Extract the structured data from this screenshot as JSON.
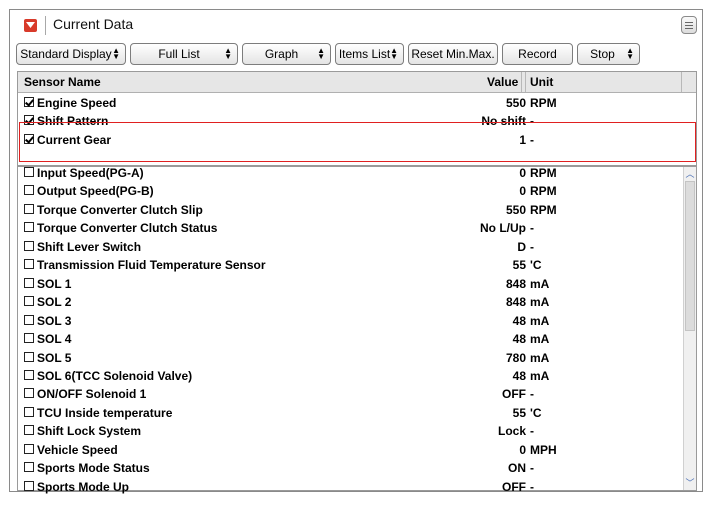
{
  "window": {
    "title": "Current Data"
  },
  "toolbar": {
    "standard_display": "Standard Display",
    "full_list": "Full List",
    "graph": "Graph",
    "items_list": "Items List",
    "reset_min_max": "Reset Min.Max.",
    "record": "Record",
    "stop": "Stop"
  },
  "table": {
    "headers": {
      "name": "Sensor Name",
      "value": "Value",
      "unit": "Unit"
    },
    "pinned_rows": [
      {
        "checked": true,
        "name": "Engine Speed",
        "value": "550",
        "unit": "RPM"
      },
      {
        "checked": true,
        "name": "Shift Pattern",
        "value": "No shift",
        "unit": "-"
      },
      {
        "checked": true,
        "name": "Current Gear",
        "value": "1",
        "unit": "-"
      }
    ],
    "rows": [
      {
        "checked": false,
        "name": "Input Speed(PG-A)",
        "value": "0",
        "unit": "RPM"
      },
      {
        "checked": false,
        "name": "Output Speed(PG-B)",
        "value": "0",
        "unit": "RPM"
      },
      {
        "checked": false,
        "name": "Torque Converter Clutch Slip",
        "value": "550",
        "unit": "RPM"
      },
      {
        "checked": false,
        "name": "Torque Converter Clutch Status",
        "value": "No L/Up",
        "unit": "-"
      },
      {
        "checked": false,
        "name": "Shift Lever Switch",
        "value": "D",
        "unit": "-"
      },
      {
        "checked": false,
        "name": "Transmission Fluid Temperature Sensor",
        "value": "55",
        "unit": "'C"
      },
      {
        "checked": false,
        "name": "SOL 1",
        "value": "848",
        "unit": "mA"
      },
      {
        "checked": false,
        "name": "SOL 2",
        "value": "848",
        "unit": "mA"
      },
      {
        "checked": false,
        "name": "SOL 3",
        "value": "48",
        "unit": "mA"
      },
      {
        "checked": false,
        "name": "SOL 4",
        "value": "48",
        "unit": "mA"
      },
      {
        "checked": false,
        "name": "SOL 5",
        "value": "780",
        "unit": "mA"
      },
      {
        "checked": false,
        "name": "SOL 6(TCC Solenoid Valve)",
        "value": "48",
        "unit": "mA"
      },
      {
        "checked": false,
        "name": "ON/OFF Solenoid 1",
        "value": "OFF",
        "unit": "-"
      },
      {
        "checked": false,
        "name": "TCU Inside temperature",
        "value": "55",
        "unit": "'C"
      },
      {
        "checked": false,
        "name": "Shift Lock System",
        "value": "Lock",
        "unit": "-"
      },
      {
        "checked": false,
        "name": "Vehicle Speed",
        "value": "0",
        "unit": "MPH"
      },
      {
        "checked": false,
        "name": "Sports Mode Status",
        "value": "ON",
        "unit": "-"
      },
      {
        "checked": false,
        "name": "Sports Mode Up",
        "value": "OFF",
        "unit": "-"
      }
    ]
  },
  "colors": {
    "highlight": "#e02020",
    "title_icon": "#d83a2a",
    "scroll_arrow": "#4a6fb5"
  }
}
